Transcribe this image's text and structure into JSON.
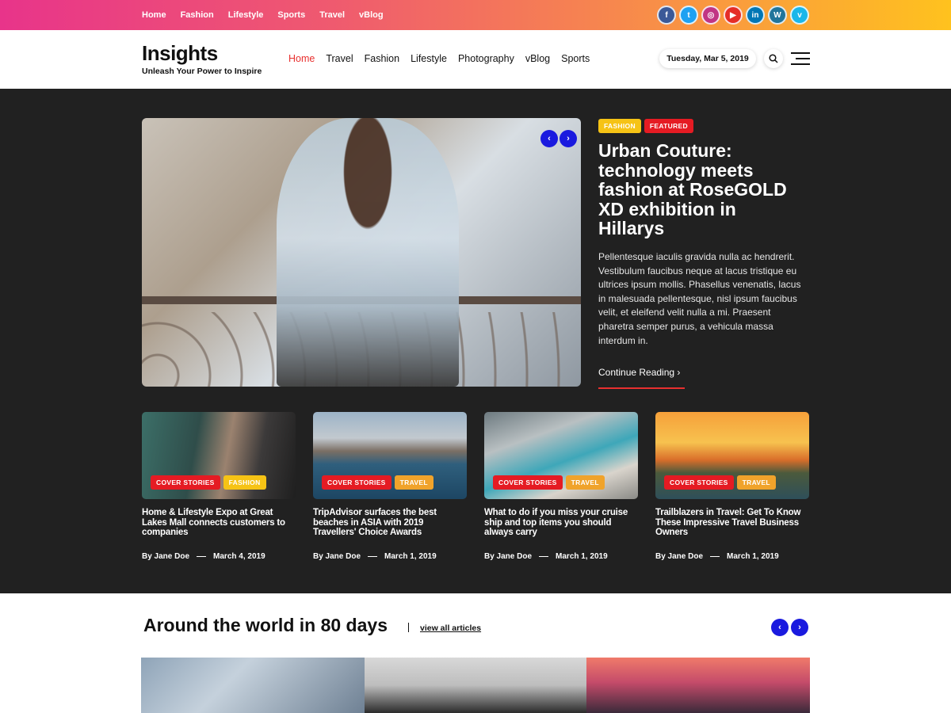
{
  "topbar": {
    "nav": [
      "Home",
      "Fashion",
      "Lifestyle",
      "Sports",
      "Travel",
      "vBlog"
    ],
    "socials": [
      {
        "icon": "facebook-icon",
        "glyph": "f",
        "color": "#3b5998"
      },
      {
        "icon": "twitter-icon",
        "glyph": "t",
        "color": "#1da1f2"
      },
      {
        "icon": "instagram-icon",
        "glyph": "◎",
        "color": "#c13584"
      },
      {
        "icon": "youtube-icon",
        "glyph": "▶",
        "color": "#e52d27"
      },
      {
        "icon": "linkedin-icon",
        "glyph": "in",
        "color": "#0077b5"
      },
      {
        "icon": "wordpress-icon",
        "glyph": "W",
        "color": "#21759b"
      },
      {
        "icon": "vimeo-icon",
        "glyph": "v",
        "color": "#1ab7ea"
      }
    ]
  },
  "header": {
    "logo": "Insights",
    "tagline": "Unleash Your Power to Inspire",
    "nav": [
      "Home",
      "Travel",
      "Fashion",
      "Lifestyle",
      "Photography",
      "vBlog",
      "Sports"
    ],
    "active_nav": "Home",
    "date": "Tuesday, Mar 5, 2019"
  },
  "hero": {
    "tags": [
      "FASHION",
      "FEATURED"
    ],
    "title": "Urban Couture: technology meets fashion at RoseGOLD XD exhibition in Hillarys",
    "excerpt": "Pellentesque iaculis gravida nulla ac hendrerit. Vestibulum faucibus neque at lacus tristique eu ultrices ipsum mollis. Phasellus venenatis, lacus in malesuada pellentesque, nisl ipsum faucibus velit, et eleifend velit nulla a mi. Praesent pharetra semper purus, a vehicula massa interdum in.",
    "continue_label": "Continue Reading",
    "continue_icon": "chevron-right-icon"
  },
  "cards": [
    {
      "tags": [
        "COVER STORIES",
        "FASHION"
      ],
      "title": "Home & Lifestyle Expo at Great Lakes Mall connects customers to companies",
      "author": "By Jane Doe",
      "date": "March 4, 2019"
    },
    {
      "tags": [
        "COVER STORIES",
        "TRAVEL"
      ],
      "title": "TripAdvisor surfaces the best beaches in ASIA with 2019 Travellers' Choice Awards",
      "author": "By Jane Doe",
      "date": "March 1, 2019"
    },
    {
      "tags": [
        "COVER STORIES",
        "TRAVEL"
      ],
      "title": "What to do if you miss your cruise ship and top items you should always carry",
      "author": "By Jane Doe",
      "date": "March 1, 2019"
    },
    {
      "tags": [
        "COVER STORIES",
        "TRAVEL"
      ],
      "title": "Trailblazers in Travel: Get To Know These Impressive Travel Business Owners",
      "author": "By Jane Doe",
      "date": "March 1, 2019"
    }
  ],
  "section": {
    "title": "Around the world in 80 days",
    "view_all": "view all articles"
  },
  "colors": {
    "accent": "#e8302f",
    "arrow_button": "#1a1adf",
    "hero_bg": "#212121",
    "tag_yellow": "#f6c315",
    "tag_red": "#e51b23",
    "tag_orange": "#f0a32b"
  }
}
